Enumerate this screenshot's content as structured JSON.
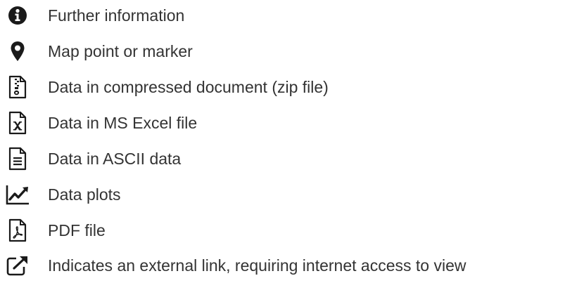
{
  "legend": {
    "items": [
      {
        "icon": "info-circle-icon",
        "label": "Further information"
      },
      {
        "icon": "map-marker-icon",
        "label": "Map point or marker"
      },
      {
        "icon": "zip-file-icon",
        "label": "Data in compressed document (zip file)"
      },
      {
        "icon": "excel-file-icon",
        "label": "Data in MS Excel file"
      },
      {
        "icon": "text-file-icon",
        "label": "Data in ASCII data"
      },
      {
        "icon": "line-chart-icon",
        "label": "Data plots"
      },
      {
        "icon": "pdf-file-icon",
        "label": "PDF file"
      },
      {
        "icon": "external-link-icon",
        "label": "Indicates an external link, requiring internet access to view"
      }
    ]
  },
  "colors": {
    "icon": "#1a1a1a",
    "text": "#333333"
  }
}
